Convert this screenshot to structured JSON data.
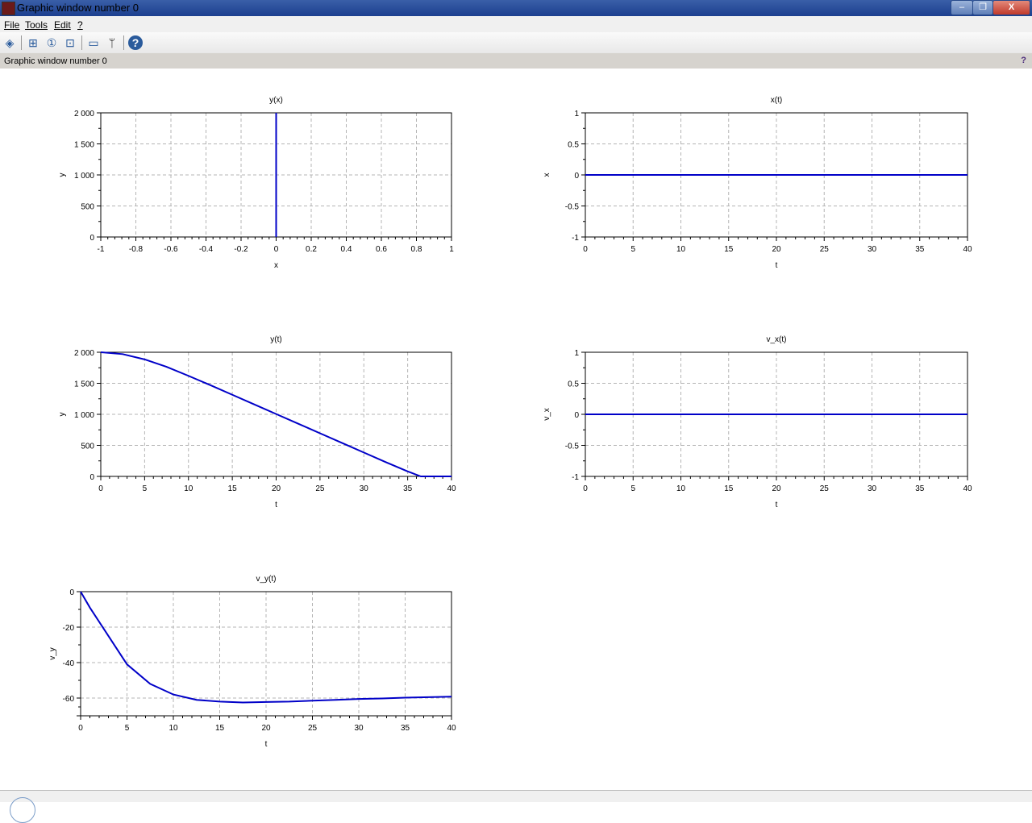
{
  "window": {
    "title": "Graphic window number 0",
    "minimize": "–",
    "restore": "❐",
    "close": "X"
  },
  "menu": [
    "File",
    "Tools",
    "Edit",
    "?"
  ],
  "toolbar": [
    {
      "icon": "rotate-icon",
      "glyph": "◈"
    },
    {
      "icon": "zoom-grid-icon",
      "glyph": "⊞"
    },
    {
      "icon": "zoom-reset-icon",
      "glyph": "①"
    },
    {
      "icon": "zoom-select-icon",
      "glyph": "⊡"
    },
    {
      "icon": "datatip-icon",
      "glyph": "▭"
    },
    {
      "icon": "datatip-edit-icon",
      "glyph": "ᛘ"
    },
    {
      "icon": "help-icon",
      "glyph": "?"
    }
  ],
  "infobar": {
    "text": "Graphic window number 0",
    "help": "?"
  },
  "colors": {
    "line": "#0000c8",
    "grid": "#b4b4b4"
  },
  "chart_data": [
    {
      "id": "yx",
      "type": "line",
      "title": "y(x)",
      "xlabel": "x",
      "ylabel": "y",
      "xlim": [
        -1,
        1
      ],
      "ylim": [
        0,
        2000
      ],
      "xticks": [
        -1,
        -0.8,
        -0.6,
        -0.4,
        -0.2,
        0,
        0.2,
        0.4,
        0.6,
        0.8,
        1
      ],
      "xtick_labels": [
        "-1",
        "-0.8",
        "-0.6",
        "-0.4",
        "-0.2",
        "0",
        "0.2",
        "0.4",
        "0.6",
        "0.8",
        "1"
      ],
      "yticks": [
        0,
        500,
        1000,
        1500,
        2000
      ],
      "ytick_labels": [
        "0",
        "500",
        "1 000",
        "1 500",
        "2 000"
      ],
      "grid": true,
      "x": [
        0,
        0
      ],
      "y": [
        0,
        2000
      ]
    },
    {
      "id": "xt",
      "type": "line",
      "title": "x(t)",
      "xlabel": "t",
      "ylabel": "x",
      "xlim": [
        0,
        40
      ],
      "ylim": [
        -1,
        1
      ],
      "xticks": [
        0,
        5,
        10,
        15,
        20,
        25,
        30,
        35,
        40
      ],
      "xtick_labels": [
        "0",
        "5",
        "10",
        "15",
        "20",
        "25",
        "30",
        "35",
        "40"
      ],
      "yticks": [
        -1,
        -0.5,
        0,
        0.5,
        1
      ],
      "ytick_labels": [
        "-1",
        "-0.5",
        "0",
        "0.5",
        "1"
      ],
      "grid": true,
      "x": [
        0,
        40
      ],
      "y": [
        0,
        0
      ]
    },
    {
      "id": "yt",
      "type": "line",
      "title": "y(t)",
      "xlabel": "t",
      "ylabel": "y",
      "xlim": [
        0,
        40
      ],
      "ylim": [
        0,
        2000
      ],
      "xticks": [
        0,
        5,
        10,
        15,
        20,
        25,
        30,
        35,
        40
      ],
      "xtick_labels": [
        "0",
        "5",
        "10",
        "15",
        "20",
        "25",
        "30",
        "35",
        "40"
      ],
      "yticks": [
        0,
        500,
        1000,
        1500,
        2000
      ],
      "ytick_labels": [
        "0",
        "500",
        "1 000",
        "1 500",
        "2 000"
      ],
      "grid": true,
      "x": [
        0,
        2.5,
        5,
        7.5,
        10,
        12.5,
        15,
        17.5,
        20,
        22.5,
        25,
        27.5,
        30,
        32.5,
        35,
        36.5,
        40
      ],
      "y": [
        2000,
        1970,
        1885,
        1765,
        1620,
        1470,
        1315,
        1160,
        1005,
        850,
        695,
        540,
        385,
        230,
        80,
        0,
        0
      ]
    },
    {
      "id": "vxt",
      "type": "line",
      "title": "v_x(t)",
      "xlabel": "t",
      "ylabel": "v_x",
      "xlim": [
        0,
        40
      ],
      "ylim": [
        -1,
        1
      ],
      "xticks": [
        0,
        5,
        10,
        15,
        20,
        25,
        30,
        35,
        40
      ],
      "xtick_labels": [
        "0",
        "5",
        "10",
        "15",
        "20",
        "25",
        "30",
        "35",
        "40"
      ],
      "yticks": [
        -1,
        -0.5,
        0,
        0.5,
        1
      ],
      "ytick_labels": [
        "-1",
        "-0.5",
        "0",
        "0.5",
        "1"
      ],
      "grid": true,
      "x": [
        0,
        40
      ],
      "y": [
        0,
        0
      ]
    },
    {
      "id": "vyt",
      "type": "line",
      "title": "v_y(t)",
      "xlabel": "t",
      "ylabel": "v_y",
      "xlim": [
        0,
        40
      ],
      "ylim": [
        -70,
        0
      ],
      "xticks": [
        0,
        5,
        10,
        15,
        20,
        25,
        30,
        35,
        40
      ],
      "xtick_labels": [
        "0",
        "5",
        "10",
        "15",
        "20",
        "25",
        "30",
        "35",
        "40"
      ],
      "yticks": [
        -60,
        -40,
        -20,
        0
      ],
      "ytick_labels": [
        "-60",
        "-40",
        "-20",
        "0"
      ],
      "grid": true,
      "x": [
        0,
        1,
        2.5,
        5,
        7.5,
        10,
        12.5,
        15,
        17.5,
        20,
        22.5,
        25,
        27.5,
        30,
        32.5,
        35,
        37.5,
        40
      ],
      "y": [
        0,
        -9,
        -21,
        -41,
        -52,
        -58,
        -61,
        -62,
        -62.5,
        -62.2,
        -62,
        -61.5,
        -61,
        -60.5,
        -60.2,
        -59.8,
        -59.5,
        -59.2
      ]
    }
  ]
}
